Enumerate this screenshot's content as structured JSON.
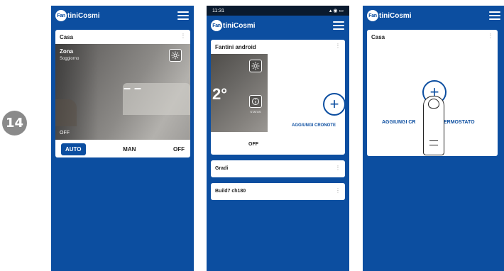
{
  "step": "14",
  "brand": {
    "logo_mark": "Fan",
    "logo_text": "tiniCosmi"
  },
  "screen1": {
    "card_title": "Casa",
    "zone": {
      "name": "Zona",
      "sub": "Soggiorno",
      "temp": "– –",
      "state": "OFF"
    },
    "modes": [
      "AUTO",
      "MAN",
      "OFF"
    ],
    "active_mode": "AUTO"
  },
  "screen2": {
    "status_time": "11:31",
    "card_title": "Fantini android",
    "temp_fragment": "2°",
    "status_label": "STATUS",
    "off_label": "OFF",
    "add_label": "AGGIUNGI CRONOTE",
    "rows": [
      "Gradi",
      "Build7 ch180"
    ]
  },
  "screen3": {
    "card_title": "Casa",
    "add_label_left": "AGGIUNGI CR",
    "add_label_right": "ERMOSTATO"
  },
  "colors": {
    "primary": "#0c4ea0",
    "badge": "#8a8a8a"
  }
}
